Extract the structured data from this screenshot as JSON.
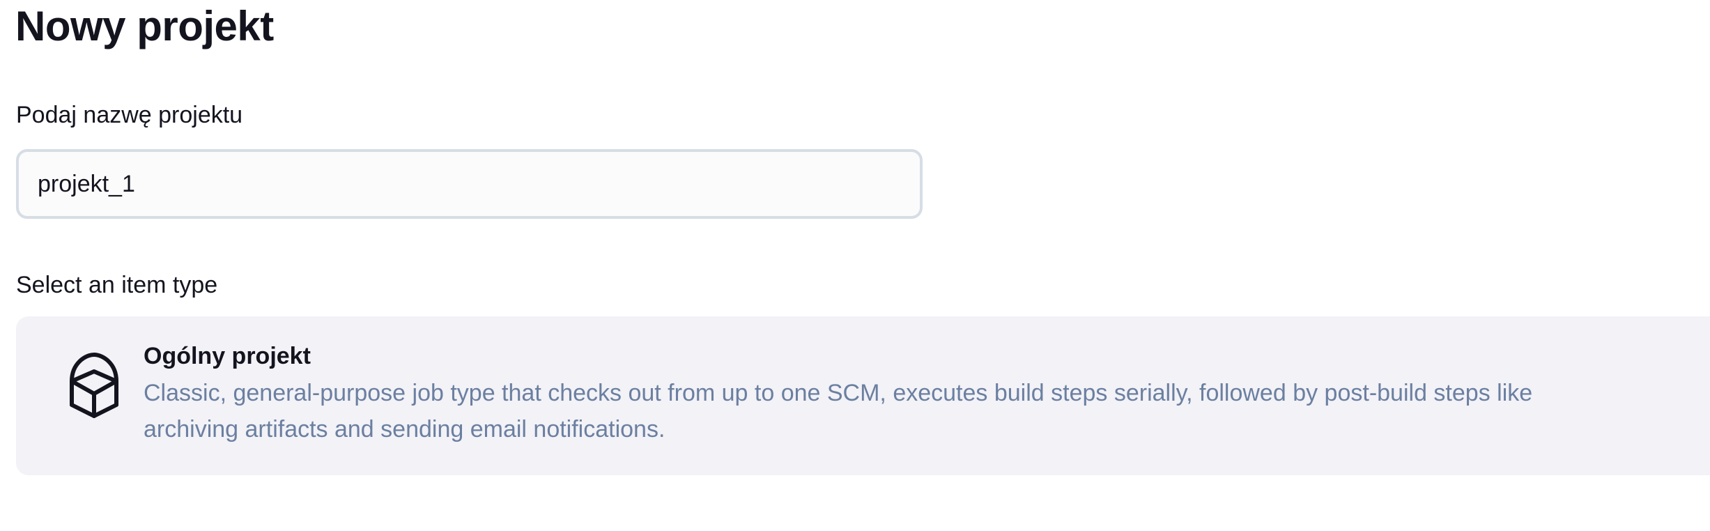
{
  "page": {
    "title": "Nowy projekt"
  },
  "name_field": {
    "label": "Podaj nazwę projektu",
    "value": "projekt_1"
  },
  "item_types": {
    "label": "Select an item type",
    "items": [
      {
        "icon": "cube-icon",
        "title": "Ogólny projekt",
        "description_lines": [
          "Classic, general-purpose job type that checks out from up to one SCM, executes build steps serially, followed by post-build steps like",
          "archiving artifacts and sending email notifications."
        ]
      }
    ]
  }
}
